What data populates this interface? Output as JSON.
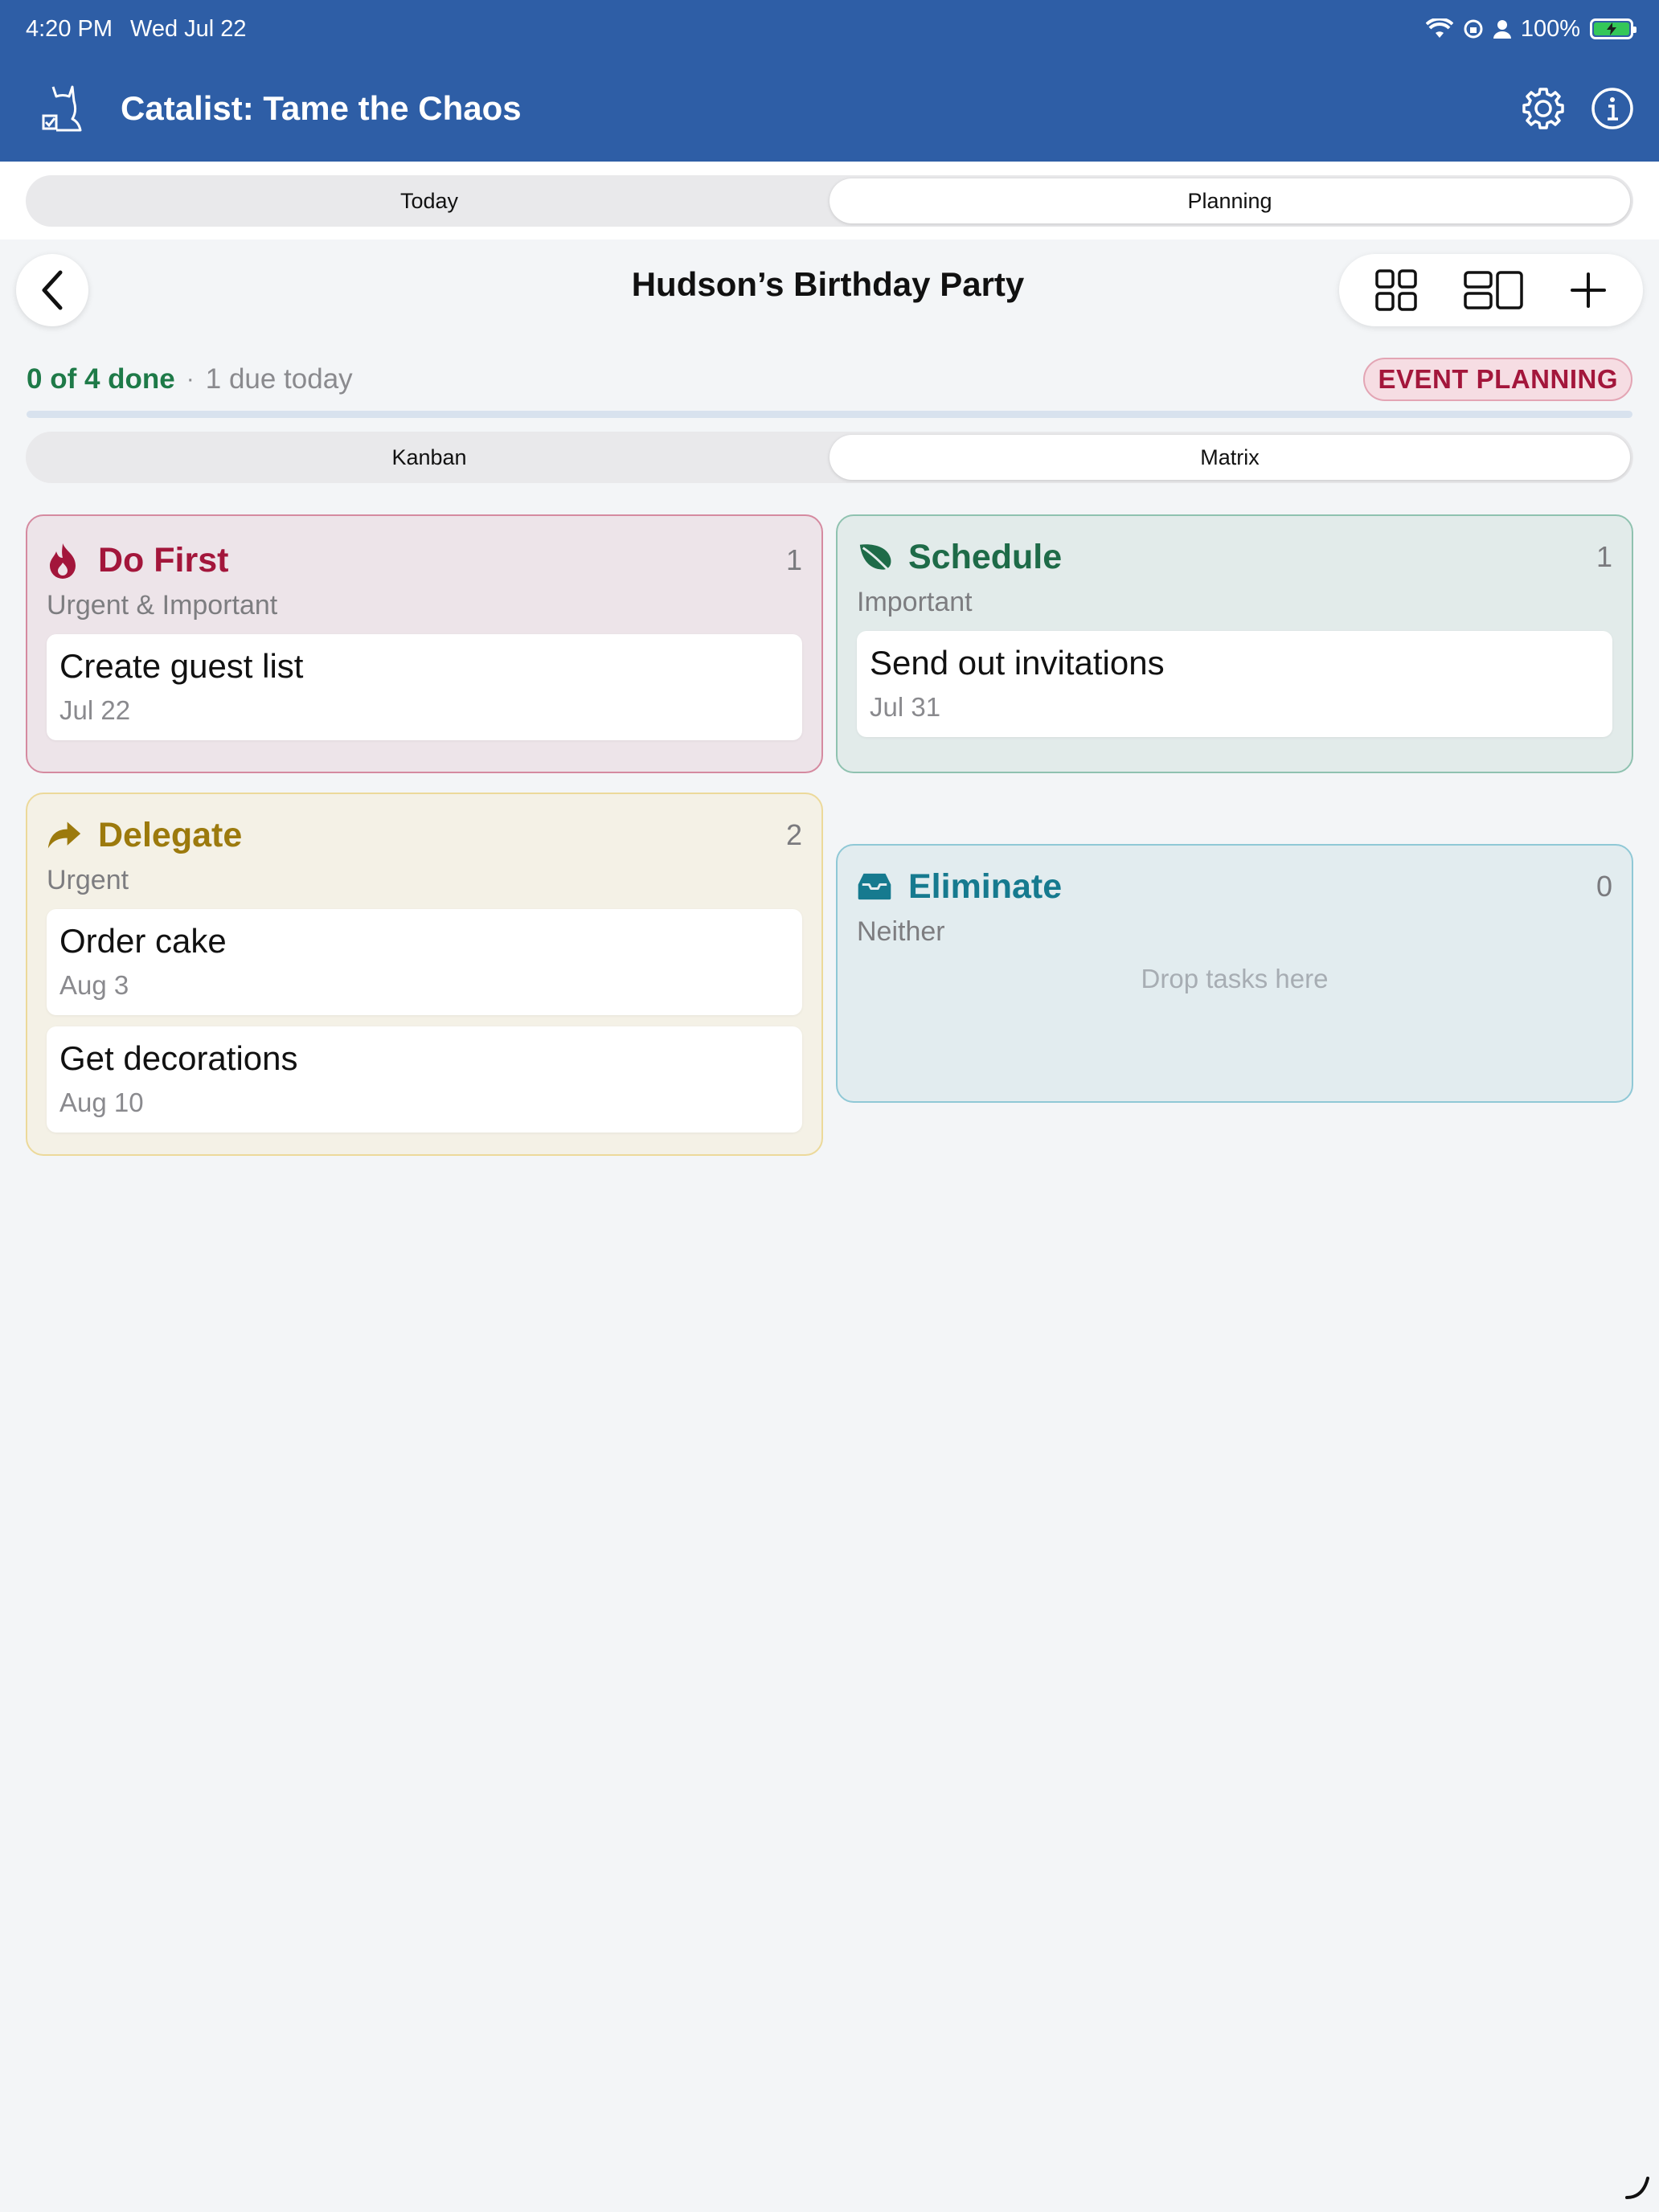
{
  "status": {
    "time": "4:20 PM",
    "date": "Wed Jul 22",
    "battery": "100%"
  },
  "app": {
    "title": "Catalist: Tame the Chaos",
    "icons": [
      "cat-logo-icon",
      "gear-icon",
      "info-icon"
    ]
  },
  "top_tabs": [
    {
      "label": "Today"
    },
    {
      "label": "Planning",
      "active": true
    }
  ],
  "project": {
    "title": "Hudson’s Birthday Party",
    "done_text": "0 of 4 done",
    "separator": "·",
    "due_text": "1 due today",
    "tag": "EVENT PLANNING",
    "progress": 0.0
  },
  "view_tabs": [
    {
      "label": "Kanban"
    },
    {
      "label": "Matrix",
      "active": true
    }
  ],
  "quadrants": {
    "do_first": {
      "title": "Do First",
      "count": "1",
      "subtitle": "Urgent & Important",
      "tasks": [
        {
          "title": "Create guest list",
          "date": "Jul 22"
        }
      ]
    },
    "schedule": {
      "title": "Schedule",
      "count": "1",
      "subtitle": "Important",
      "tasks": [
        {
          "title": "Send out invitations",
          "date": "Jul 31"
        }
      ]
    },
    "delegate": {
      "title": "Delegate",
      "count": "2",
      "subtitle": "Urgent",
      "tasks": [
        {
          "title": "Order cake",
          "date": "Aug 3"
        },
        {
          "title": "Get decorations",
          "date": "Aug 10"
        }
      ]
    },
    "eliminate": {
      "title": "Eliminate",
      "count": "0",
      "subtitle": "Neither",
      "empty_text": "Drop tasks here",
      "tasks": []
    }
  },
  "colors": {
    "header": "#2e5ea6",
    "do_first": "#a3163b",
    "schedule": "#1e6b48",
    "delegate": "#9c7a0d",
    "eliminate": "#167a8f",
    "done": "#1e7a48"
  }
}
